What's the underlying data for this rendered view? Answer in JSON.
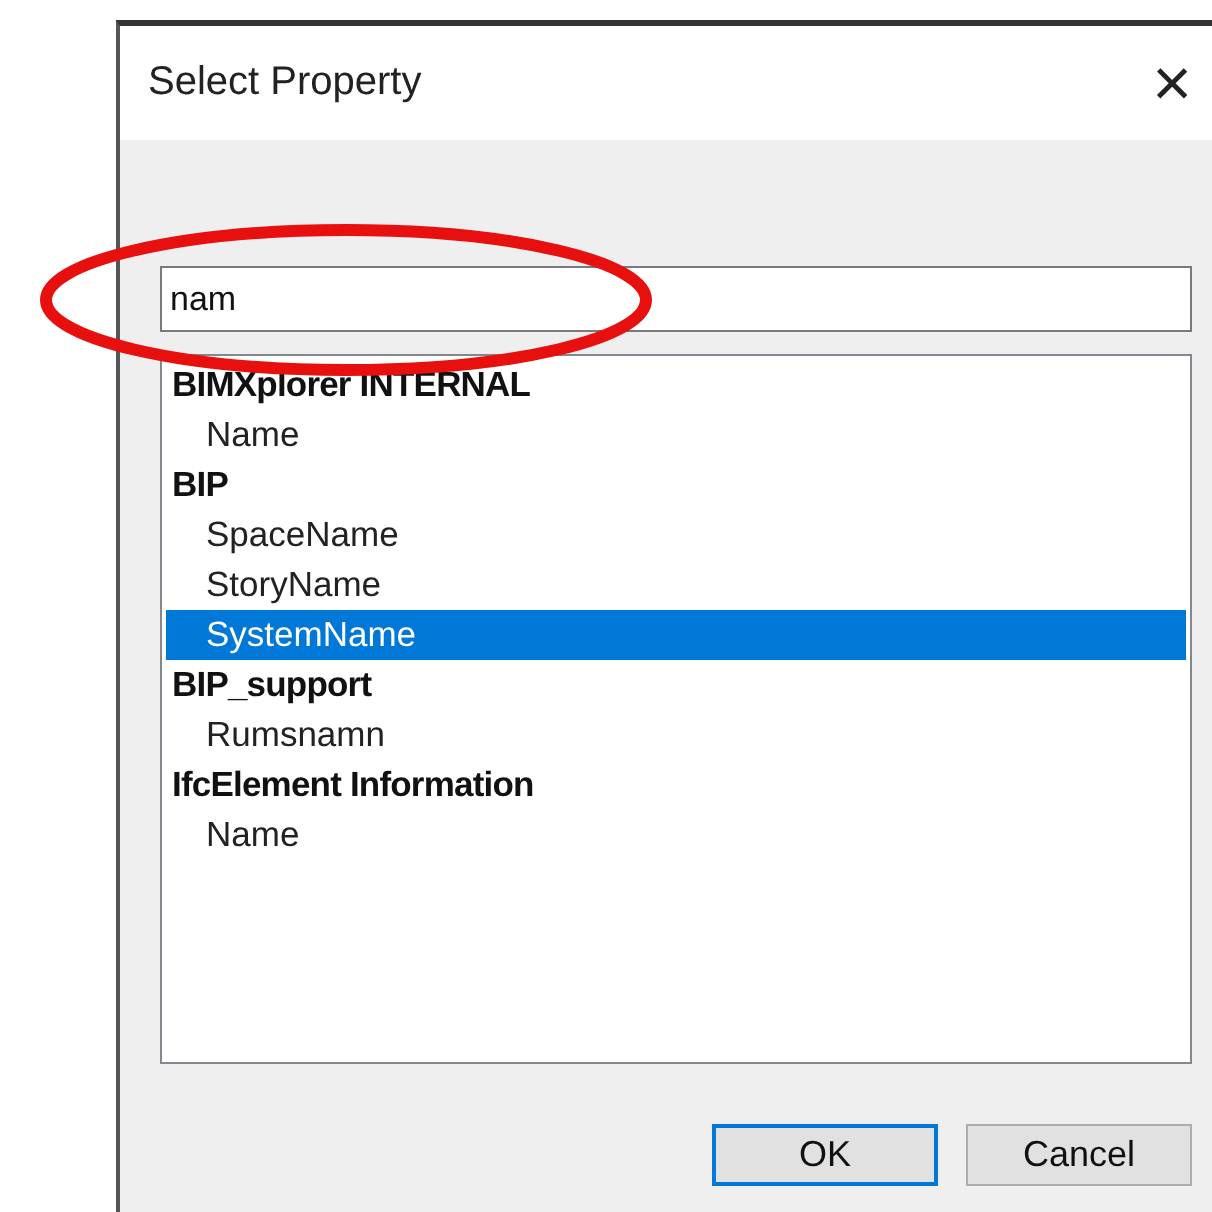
{
  "window": {
    "title": "Select Property",
    "close": "×"
  },
  "search": {
    "value": "nam"
  },
  "groups": [
    {
      "label": "BIMXplorer INTERNAL",
      "children": [
        {
          "label": "Name",
          "selected": false
        }
      ]
    },
    {
      "label": "BIP",
      "children": [
        {
          "label": "SpaceName",
          "selected": false
        },
        {
          "label": "StoryName",
          "selected": false
        },
        {
          "label": "SystemName",
          "selected": true
        }
      ]
    },
    {
      "label": "BIP_support",
      "children": [
        {
          "label": "Rumsnamn",
          "selected": false
        }
      ]
    },
    {
      "label": "IfcElement Information",
      "children": [
        {
          "label": "Name",
          "selected": false
        }
      ]
    }
  ],
  "buttons": [
    {
      "label": "OK",
      "default": true
    },
    {
      "label": "Cancel",
      "default": false
    }
  ]
}
